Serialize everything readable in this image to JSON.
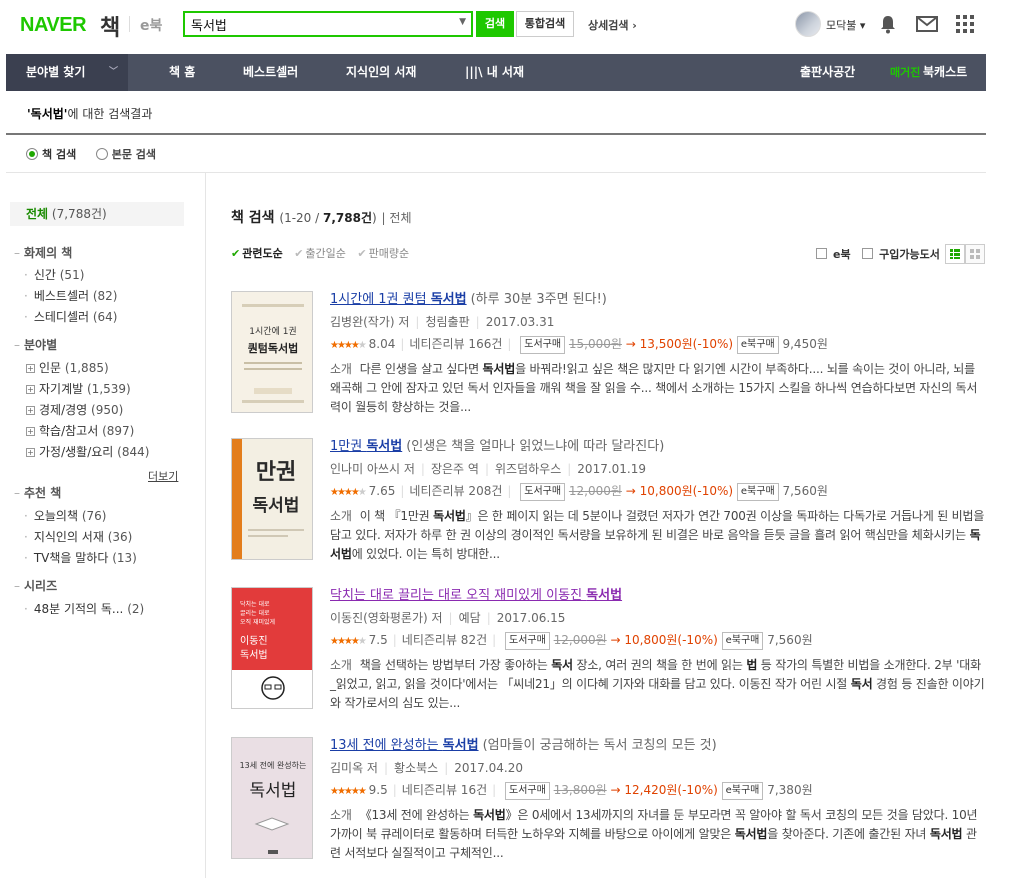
{
  "header": {
    "logo_naver": "NAVER",
    "logo_book": "책",
    "logo_ebook": "e북",
    "search_value": "독서법",
    "search_button": "검색",
    "total_search_button": "통합검색",
    "detail_search_link": "상세검색 ›",
    "user_name": "모닥불 ▾"
  },
  "nav": {
    "category_label": "분야별 찾기",
    "items": [
      "책 홈",
      "베스트셀러",
      "지식인의 서재",
      "|||\\ 내 서재",
      "출판사공간"
    ],
    "booklet_tag": "매거진",
    "booklet_label": "북캐스트"
  },
  "result_head": {
    "keyword": "'독서법'",
    "suffix": "에 대한 검색결과"
  },
  "search_type": {
    "book_search": "책 검색",
    "text_search": "본문 검색"
  },
  "sidebar": {
    "all_label": "전체",
    "all_count": "(7,788건)",
    "sections": [
      {
        "title": "화제의 책",
        "items": [
          {
            "label": "신간",
            "count": "(51)"
          },
          {
            "label": "베스트셀러",
            "count": "(82)"
          },
          {
            "label": "스테디셀러",
            "count": "(64)"
          }
        ]
      },
      {
        "title": "분야별",
        "items": [
          {
            "label": "인문",
            "count": "(1,885)"
          },
          {
            "label": "자기계발",
            "count": "(1,539)"
          },
          {
            "label": "경제/경영",
            "count": "(950)"
          },
          {
            "label": "학습/참고서",
            "count": "(897)"
          },
          {
            "label": "가정/생활/요리",
            "count": "(844)"
          }
        ]
      },
      {
        "title": "추천 책",
        "items": [
          {
            "label": "오늘의책",
            "count": "(76)"
          },
          {
            "label": "지식인의 서재",
            "count": "(36)"
          },
          {
            "label": "TV책을 말하다",
            "count": "(13)"
          }
        ]
      },
      {
        "title": "시리즈",
        "items": [
          {
            "label": "48분 기적의 독...",
            "count": "(2)"
          }
        ]
      }
    ],
    "more_link": "더보기"
  },
  "main": {
    "title": "책 검색",
    "range_prefix": "(1-20 / ",
    "range_count": "7,788건",
    "range_suffix": ")",
    "all_label": "전체",
    "sorts": [
      "관련도순",
      "출간일순",
      "판매량순"
    ],
    "filter_ebook": "e북",
    "filter_available": "구입가능도서"
  },
  "books": [
    {
      "title_pre": "1시간에 1권 퀀텀 ",
      "title_hl": "독서법",
      "title_post": "",
      "subtitle": "(하루 30분 3주면 된다!)",
      "author": "김병완(작가) 저",
      "publisher": "청림출판",
      "date": "2017.03.31",
      "rating": "8.04",
      "stars_full": 4,
      "review": "네티즌리뷰 166건",
      "buy_label": "도서구매",
      "list_price": "15,000원",
      "arrow": "→",
      "sale_price": "13,500원(-10%)",
      "ebook_label": "e북구매",
      "ebook_price": "9,450원",
      "desc_label": "소개",
      "desc_pre": "다른 인생을 살고 싶다면 ",
      "desc_hl": "독서법",
      "desc_post": "을 바꿔라!읽고 싶은 책은 많지만 다 읽기엔 시간이 부족하다.... 뇌를 속이는 것이 아니라, 뇌를 왜곡해 그 안에 잠자고 있던 독서 인자들을 깨워 책을 잘 읽을 수... 책에서 소개하는 15가지 스킬을 하나씩 연습하다보면 자신의 독서력이 월등히 향상하는 것을...",
      "cover_title": "1시간에 1권 퀀텀독서법"
    },
    {
      "title_pre": "1만권 ",
      "title_hl": "독서법",
      "title_post": "",
      "subtitle": "(인생은 책을 얼마나 읽었느냐에 따라 달라진다)",
      "author": "인나미 아쓰시 저",
      "translator": "장은주 역",
      "publisher": "위즈덤하우스",
      "date": "2017.01.19",
      "rating": "7.65",
      "stars_full": 4,
      "review": "네티즌리뷰 208건",
      "buy_label": "도서구매",
      "list_price": "12,000원",
      "arrow": "→",
      "sale_price": "10,800원(-10%)",
      "ebook_label": "e북구매",
      "ebook_price": "7,560원",
      "desc_label": "소개",
      "desc_pre": "이 책 『1만권 ",
      "desc_hl": "독서법",
      "desc_post": "』은 한 페이지 읽는 데 5분이나 걸렸던 저자가 연간 700권 이상을 독파하는 다독가로 거듭나게 된 비법을 담고 있다. 저자가 하루 한 권 이상의 경이적인 독서량을 보유하게 된 비결은 바로 음악을 듣듯 글을 흘려 읽어 핵심만을 체화시키는 ",
      "desc_hl2": "독서법",
      "desc_post2": "에 있었다. 이는 특히 방대한...",
      "cover_title": "1만권 독서법"
    },
    {
      "title_pre": "닥치는 대로 끌리는 대로 오직 재미있게 이동진 ",
      "title_hl": "독서법",
      "title_post": "",
      "subtitle": "",
      "author": "이동진(영화평론가) 저",
      "publisher": "예담",
      "date": "2017.06.15",
      "rating": "7.5",
      "stars_full": 4,
      "review": "네티즌리뷰 82건",
      "buy_label": "도서구매",
      "list_price": "12,000원",
      "arrow": "→",
      "sale_price": "10,800원(-10%)",
      "ebook_label": "e북구매",
      "ebook_price": "7,560원",
      "desc_label": "소개",
      "desc_pre": "책을 선택하는 방법부터 가장 좋아하는 ",
      "desc_hl": "독서",
      "desc_post": " 장소, 여러 권의 책을 한 번에 읽는 ",
      "desc_hl2": "법",
      "desc_post2": " 등 작가의 특별한 비법을 소개한다. 2부 '대화_읽었고, 읽고, 읽을 것이다'에서는 「씨네21」의 이다혜 기자와 대화를 담고 있다. 이동진 작가 어린 시절 ",
      "desc_hl3": "독서",
      "desc_post3": " 경험 등 진솔한 이야기와 작가로서의 심도 있는...",
      "cover_title": "이동진 독서법"
    },
    {
      "title_pre": "13세 전에 완성하는 ",
      "title_hl": "독서법",
      "title_post": "",
      "subtitle": "(엄마들이 궁금해하는 독서 코칭의 모든 것)",
      "author": "김미옥 저",
      "publisher": "황소북스",
      "date": "2017.04.20",
      "rating": "9.5",
      "stars_full": 5,
      "review": "네티즌리뷰 16건",
      "buy_label": "도서구매",
      "list_price": "13,800원",
      "arrow": "→",
      "sale_price": "12,420원(-10%)",
      "ebook_label": "e북구매",
      "ebook_price": "7,380원",
      "desc_label": "소개",
      "desc_pre": "《13세 전에 완성하는 ",
      "desc_hl": "독서법",
      "desc_post": "》은 0세에서 13세까지의 자녀를 둔 부모라면 꼭 알아야 할 독서 코칭의 모든 것을 담았다. 10년 가까이 북 큐레이터로 활동하며 터득한 노하우와 지혜를 바탕으로 아이에게 알맞은 ",
      "desc_hl2": "독서법",
      "desc_post2": "을 찾아준다. 기존에 출간된 자녀 ",
      "desc_hl3": "독서법",
      "desc_post3": " 관련 서적보다 실질적이고 구체적인...",
      "cover_title": "13세 전에 완성하는 독서법"
    }
  ]
}
